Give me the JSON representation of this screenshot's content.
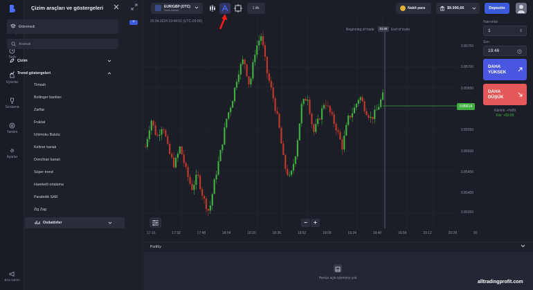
{
  "rail": {
    "items": [
      {
        "label": "Portföy",
        "icon": "portfolio-icon"
      },
      {
        "label": "Tarih",
        "icon": "clock-icon"
      },
      {
        "label": "Uyarılar",
        "icon": "bell-icon"
      },
      {
        "label": "Sıralama",
        "icon": "trophy-icon"
      },
      {
        "label": "Yardım",
        "icon": "help-icon"
      },
      {
        "label": "Ayarlar",
        "icon": "gear-icon"
      }
    ],
    "help_label": "Bize katılın"
  },
  "panel": {
    "title": "Çizim araçları ve göstergeleri",
    "favorites_label": "Eklenmedi",
    "add_label": "+",
    "search_placeholder": "Aramak",
    "drawing_label": "Çizim",
    "trend_label": "Trend göstergeleri",
    "indicators": [
      "Timsah",
      "Bollinger bantları",
      "Zarflar",
      "Fraktal",
      "Ichimoku Bulutu",
      "Keltner kanalı",
      "Donchian kanalı",
      "Süper trend",
      "Hareketli ortalama",
      "Parabolik SAR",
      "Zig Zag"
    ],
    "oscillators_label": "Osilatörler"
  },
  "topbar": {
    "pair": "EUR/GBP (OTC)",
    "pair_sub": "Sabit zaman",
    "timeframe": "1 dk.",
    "cash_label": "Nakit para",
    "balance": "$9.990,66",
    "deposit_label": "Depozito"
  },
  "chart_info": {
    "datetime": "20.04.2024 19:44:51 (UTC-03:00)",
    "begin_label": "Beginning of trade",
    "timer": "01:09",
    "end_label": "End of trade",
    "current_price": "0.85614"
  },
  "chart_data": {
    "type": "candlestick",
    "y_ticks": [
      "0.85750",
      "0.85700",
      "0.85650",
      "0.85600",
      "0.85550",
      "0.85500",
      "0.85450",
      "0.85400",
      "0.85350"
    ],
    "x_ticks": [
      "17:16",
      "17:32",
      "17:48",
      "18:04",
      "18:20",
      "18:36",
      "18:52",
      "19:08",
      "19:24",
      "19:40",
      "19:56",
      "20:12",
      "20:28",
      "20:4"
    ],
    "ylim": [
      0.85325,
      0.8578
    ],
    "close_path": [
      0.855,
      0.8556,
      0.8552,
      0.8555,
      0.8549,
      0.8546,
      0.855,
      0.8545,
      0.8541,
      0.8544,
      0.8539,
      0.8536,
      0.8543,
      0.8549,
      0.8556,
      0.856,
      0.8566,
      0.8569,
      0.8563,
      0.8571,
      0.8574,
      0.8566,
      0.8561,
      0.8555,
      0.8546,
      0.8543,
      0.8549,
      0.8559,
      0.8561,
      0.8553,
      0.8556,
      0.856,
      0.8557,
      0.8554,
      0.855,
      0.8556,
      0.8558,
      0.8561,
      0.8558,
      0.8556,
      0.8558,
      0.8561
    ]
  },
  "right_panel": {
    "amount_label": "Yatırımlar",
    "amount_value": "1",
    "amount_suffix": "$",
    "time_label": "Son",
    "time_value": "19:46",
    "up_label_1": "DAHA",
    "up_label_2": "YÜKSEK",
    "down_label_1": "DAHA",
    "down_label_2": "DÜŞÜK",
    "profitability": "Kârlılık: +%89",
    "profit": "Kâr: +$0,89"
  },
  "portfolio": {
    "title": "Portföy",
    "empty_text": "Henüz açık işleminiz yok"
  },
  "watermark": "alltradingprofit.com",
  "colors": {
    "accent": "#4a6cf7",
    "up": "#3fae3f",
    "down": "#e5585a",
    "bull_candle": "#3fae3f",
    "bear_candle": "#c0392b"
  }
}
